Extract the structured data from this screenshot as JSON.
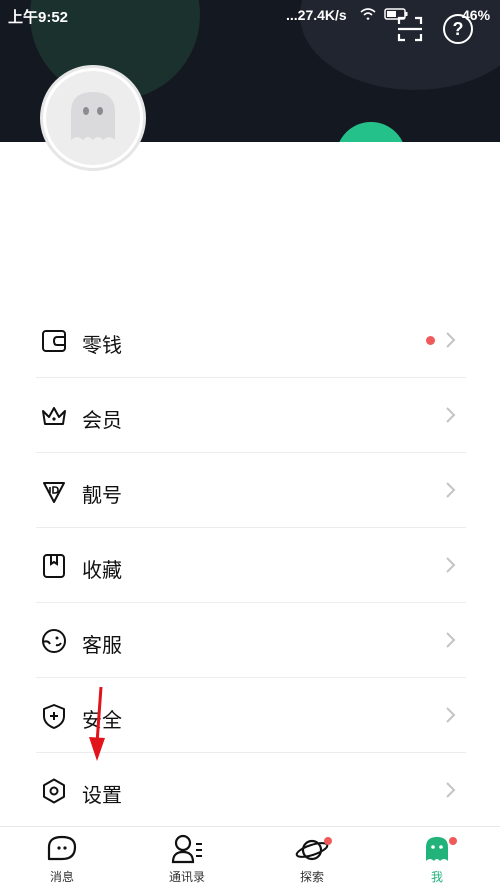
{
  "status_bar": {
    "time": "上午9:52",
    "network_speed": "...27.4K/s",
    "battery": "46%"
  },
  "header": {
    "scan_icon": "scan-icon",
    "help_label": "?"
  },
  "menu": {
    "items": [
      {
        "label": "零钱",
        "icon": "wallet-icon",
        "has_dot": true
      },
      {
        "label": "会员",
        "icon": "crown-icon"
      },
      {
        "label": "靓号",
        "icon": "id-badge-icon"
      },
      {
        "label": "收藏",
        "icon": "bookmark-icon"
      },
      {
        "label": "客服",
        "icon": "customer-service-icon"
      },
      {
        "label": "安全",
        "icon": "shield-icon"
      },
      {
        "label": "设置",
        "icon": "hexagon-settings-icon"
      }
    ]
  },
  "tabbar": {
    "tabs": [
      {
        "label": "消息",
        "icon": "chat-bubble-icon"
      },
      {
        "label": "通讯录",
        "icon": "contacts-icon"
      },
      {
        "label": "探索",
        "icon": "planet-icon",
        "has_dot": true
      },
      {
        "label": "我",
        "icon": "me-icon",
        "active": true,
        "has_dot": true
      }
    ]
  },
  "colors": {
    "header_bg": "#141821",
    "accent": "#22b37b",
    "dot": "#f05a5a"
  }
}
